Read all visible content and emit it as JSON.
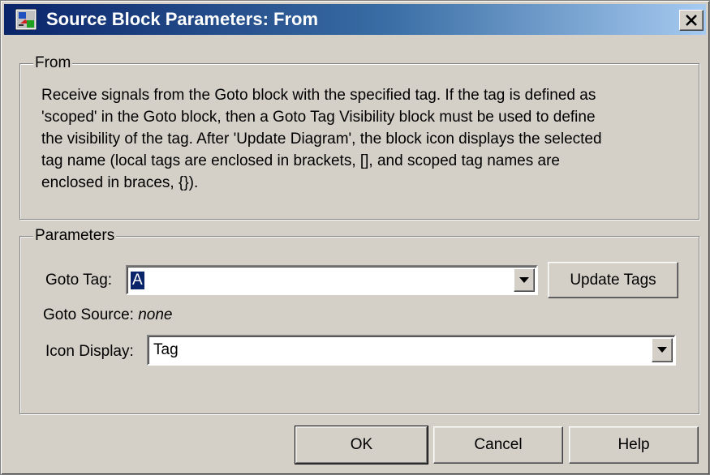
{
  "window": {
    "title": "Source Block Parameters: From",
    "close_symbol": "✕"
  },
  "from_group": {
    "legend": "From",
    "description_lines": [
      "Receive signals from the Goto block with the specified tag.  If the tag is defined as",
      "'scoped' in the Goto block, then a Goto Tag Visibility block must be used to define",
      "the visibility of the tag.  After 'Update Diagram', the block icon displays the selected",
      "tag name  (local tags are enclosed in brackets, [], and scoped tag names are",
      "enclosed in braces, {})."
    ]
  },
  "parameters_group": {
    "legend": "Parameters",
    "goto_tag": {
      "label": "Goto Tag:",
      "value": "A"
    },
    "update_tags_label": "Update Tags",
    "goto_source": {
      "label": "Goto Source:",
      "value": "none"
    },
    "icon_display": {
      "label": "Icon Display:",
      "value": "Tag"
    }
  },
  "footer": {
    "ok_label": "OK",
    "cancel_label": "Cancel",
    "help_label": "Help"
  },
  "icons": {
    "app": "simulink-block-icon",
    "dropdown": "dropdown-arrow-icon",
    "close": "close-icon"
  },
  "colors": {
    "title_gradient_start": "#0a246a",
    "title_gradient_end": "#a6caf0",
    "dialog_face": "#d4d0c8",
    "selection": "#0a246a"
  }
}
